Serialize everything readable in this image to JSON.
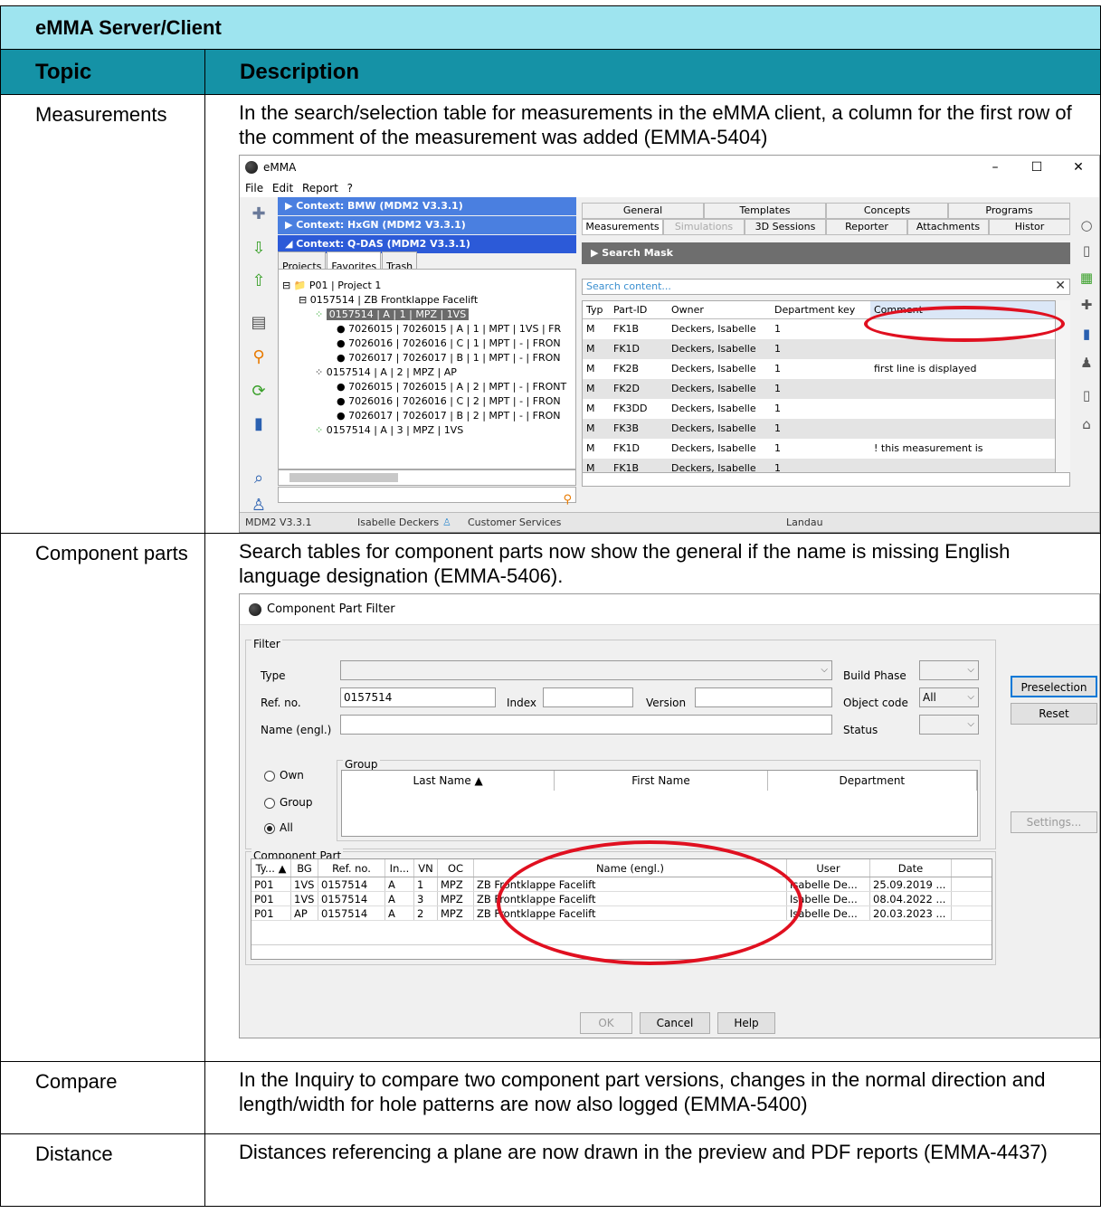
{
  "document": {
    "title": "eMMA Server/Client",
    "header": {
      "topic": "Topic",
      "description": "Description"
    },
    "rows": [
      {
        "topic": "Measurements",
        "description": "In the search/selection table for measurements in the eMMA client, a column for the first row of the comment of the measurement was added (EMMA-5404)"
      },
      {
        "topic": "Component parts",
        "description": "Search tables for component parts now show the general if the name is missing English language designation (EMMA-5406)."
      },
      {
        "topic": "Compare",
        "description": "In the Inquiry to compare two component part versions, changes in the normal direction and length/width for hole patterns are now also logged (EMMA-5400)"
      },
      {
        "topic": "Distance",
        "description": "Distances referencing a plane are now drawn in the preview and PDF reports (EMMA-4437)"
      }
    ]
  },
  "emma_window": {
    "title": "eMMA",
    "controls": [
      "–",
      "☐",
      "✕"
    ],
    "menu": [
      "File",
      "Edit",
      "Report",
      "?"
    ],
    "contexts": [
      {
        "label": "▶ Context: BMW (MDM2 V3.3.1)"
      },
      {
        "label": "▶ Context: HxGN (MDM2 V3.3.1)"
      },
      {
        "label": "◢ Context: Q-DAS (MDM2 V3.3.1)"
      }
    ],
    "left_tabs": [
      "Projects",
      "Favorites",
      "Trash"
    ],
    "tree": [
      "⊟ 📁 P01 | Project 1",
      "⊟ 0157514 | ZB Frontklappe Facelift",
      "0157514 | A | 1 | MPZ | 1VS",
      "● 7026015 | 7026015 | A | 1 | MPT | 1VS | FR",
      "● 7026016 | 7026016 | C | 1 | MPT | - | FRON",
      "● 7026017 | 7026017 | B | 1 | MPT | - | FRON",
      "0157514 | A | 2 | MPZ | AP",
      "● 7026015 | 7026015 | A | 2 | MPT | - | FRONT",
      "● 7026016 | 7026016 | C | 2 | MPT | - | FRON",
      "● 7026017 | 7026017 | B | 2 | MPT | - | FRON",
      "0157514 | A | 3 | MPZ | 1VS"
    ],
    "tabs_row1": [
      "General",
      "Templates",
      "Concepts",
      "Programs"
    ],
    "tabs_row2": [
      "Measurements",
      "Simulations",
      "3D Sessions",
      "Reporter",
      "Attachments",
      "Histor"
    ],
    "search_mask": "▶ Search Mask",
    "search_placeholder": "Search content...",
    "grid_headers": [
      "Typ",
      "Part-ID",
      "Owner",
      "Department key",
      "Comment"
    ],
    "grid_rows": [
      [
        "M",
        "FK1B",
        "Deckers, Isabelle",
        "1",
        ""
      ],
      [
        "M",
        "FK1D",
        "Deckers, Isabelle",
        "1",
        ""
      ],
      [
        "M",
        "FK2B",
        "Deckers, Isabelle",
        "1",
        "first line is displayed"
      ],
      [
        "M",
        "FK2D",
        "Deckers, Isabelle",
        "1",
        ""
      ],
      [
        "M",
        "FK3DD",
        "Deckers, Isabelle",
        "1",
        ""
      ],
      [
        "M",
        "FK3B",
        "Deckers, Isabelle",
        "1",
        ""
      ],
      [
        "M",
        "FK1D",
        "Deckers, Isabelle",
        "1",
        "! this measurement is"
      ],
      [
        "M",
        "FK1B",
        "Deckers, Isabelle",
        "1",
        ""
      ]
    ],
    "status": {
      "version": "MDM2 V3.3.1",
      "user": "Isabelle Deckers",
      "department": "Customer Services",
      "location": "Landau"
    },
    "highlight_color": "#e01020"
  },
  "filter_dialog": {
    "title": "Component Part Filter",
    "filter_legend": "Filter",
    "labels": {
      "type": "Type",
      "ref_no": "Ref. no.",
      "index": "Index",
      "version": "Version",
      "name": "Name (engl.)",
      "build_phase": "Build Phase",
      "object_code": "Object code",
      "status": "Status"
    },
    "values": {
      "ref_no": "0157514",
      "object_code": "All"
    },
    "buttons": {
      "preselection": "Preselection",
      "reset": "Reset",
      "settings": "Settings...",
      "ok": "OK",
      "cancel": "Cancel",
      "help": "Help"
    },
    "radios": [
      {
        "label": "Own",
        "checked": false
      },
      {
        "label": "Group",
        "checked": false
      },
      {
        "label": "All",
        "checked": true
      }
    ],
    "group_legend": "Group",
    "group_headers": [
      "Last Name ▲",
      "First Name",
      "Department"
    ],
    "cp_legend": "Component Part",
    "cp_headers": [
      "Ty... ▲",
      "BG",
      "Ref. no.",
      "In...",
      "VN",
      "OC",
      "Name (engl.)",
      "User",
      "Date"
    ],
    "cp_rows": [
      [
        "P01",
        "1VS",
        "0157514",
        "A",
        "1",
        "MPZ",
        "ZB Frontklappe Facelift",
        "Isabelle De...",
        "25.09.2019 ..."
      ],
      [
        "P01",
        "1VS",
        "0157514",
        "A",
        "3",
        "MPZ",
        "ZB Frontklappe Facelift",
        "Isabelle De...",
        "08.04.2022 ..."
      ],
      [
        "P01",
        "AP",
        "0157514",
        "A",
        "2",
        "MPZ",
        "ZB Frontklappe Facelift",
        "Isabelle De...",
        "20.03.2023 ..."
      ]
    ]
  }
}
